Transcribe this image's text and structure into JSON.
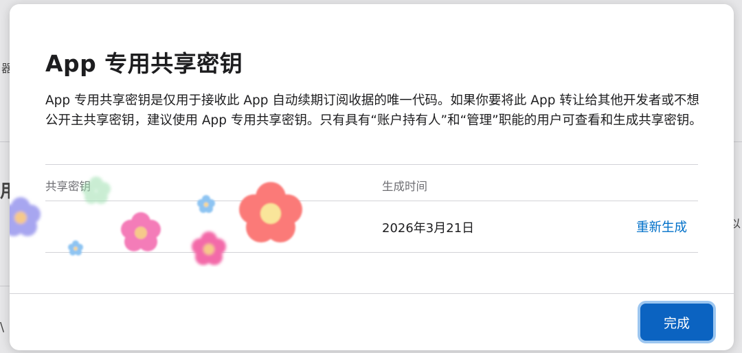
{
  "dialog": {
    "title": "App 专用共享密钥",
    "description": "App 专用共享密钥是仅用于接收此 App 自动续期订阅收据的唯一代码。如果你要将此 App 转让给其他开发者或不想公开主共享密钥，建议使用 App 专用共享密钥。只有具有“账户持有人”和“管理”职能的用户可查看和生成共享密钥。",
    "table": {
      "headers": {
        "key": "共享密钥",
        "created": "生成时间"
      },
      "rows": [
        {
          "key": "",
          "created": "2026年3月21日",
          "action": "重新生成"
        }
      ]
    },
    "done_label": "完成"
  },
  "background_fragments": {
    "left_a": "器",
    "left_b": "用",
    "right_a": "以",
    "bottom_left": "\\"
  },
  "colors": {
    "accent": "#0b63c1",
    "link": "#0070c9",
    "divider": "#d2d2d7"
  },
  "key_mask_description_icon": "flower-sticker-icon"
}
